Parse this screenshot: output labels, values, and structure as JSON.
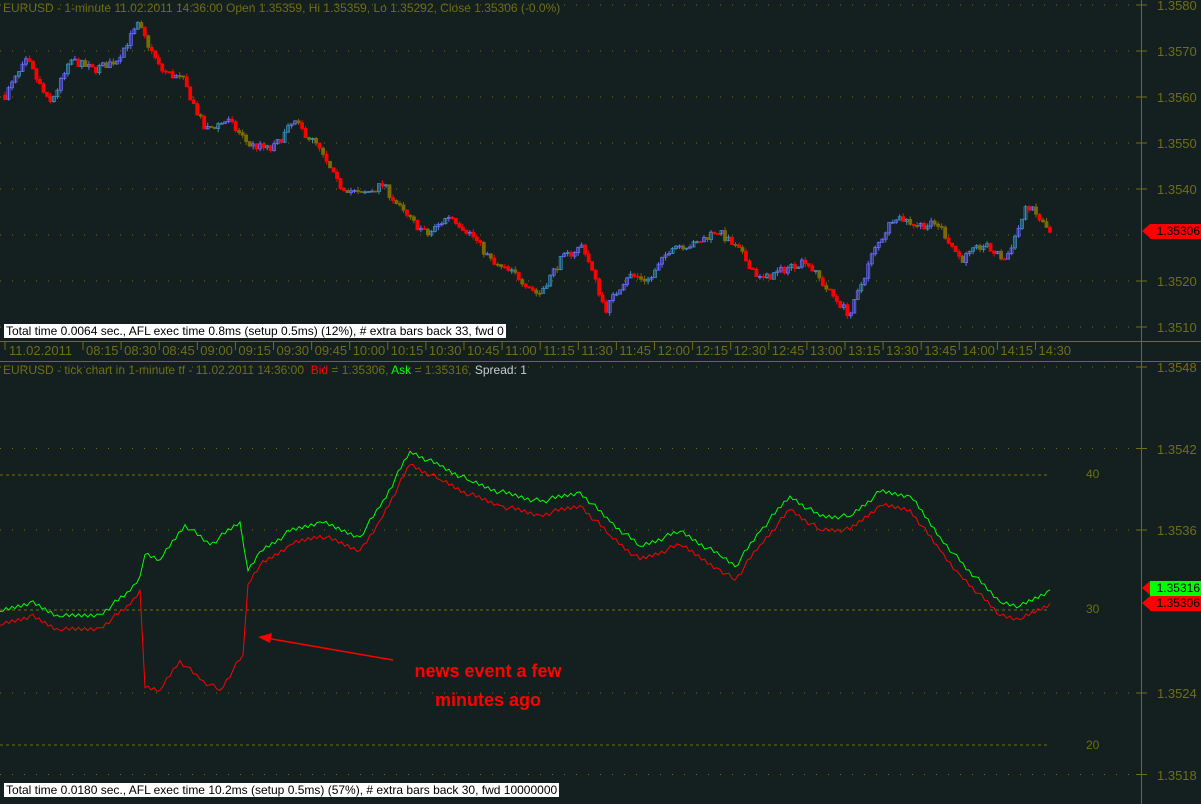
{
  "top_pane": {
    "title": "EURUSD - 1-minute 11.02.2011 14:36:00 Open 1.35359, Hi 1.35359, Lo 1.35292, Close 1.35306 (-0.0%)",
    "status": "Total time 0.0064 sec., AFL exec time 0.8ms (setup 0.5ms) (12%), # extra bars back 33, fwd 0",
    "price_labels": [
      "1.3580",
      "1.3570",
      "1.3560",
      "1.3550",
      "1.3540",
      "1.3520",
      "1.3510"
    ],
    "last_price": "1.35306"
  },
  "time_axis": {
    "date": "11.02.2011",
    "labels": [
      "08:15",
      "08:30",
      "08:45",
      "09:00",
      "09:15",
      "09:30",
      "09:45",
      "10:00",
      "10:15",
      "10:30",
      "10:45",
      "11:00",
      "11:15",
      "11:30",
      "11:45",
      "12:00",
      "12:15",
      "12:30",
      "12:45",
      "13:00",
      "13:15",
      "13:30",
      "13:45",
      "14:00",
      "14:15",
      "14:30"
    ]
  },
  "bottom_pane": {
    "title": "EURUSD - tick chart in 1-minute tf - 11.02.2011 14:36:00",
    "bid_label": "Bid",
    "bid_value": " = 1.35306, ",
    "ask_label": "Ask",
    "ask_value": " = 1.35316, ",
    "spread": "Spread: 1",
    "status": "Total time 0.0180 sec., AFL exec time 10.2ms (setup 0.5ms) (57%), # extra bars back 30, fwd 10000000",
    "price_labels": [
      "1.3548",
      "1.3542",
      "1.3536",
      "1.3524",
      "1.3518"
    ],
    "spread_scale": [
      "40",
      "30",
      "20"
    ],
    "ask_tag": "1.35316",
    "bid_tag": "1.35306",
    "annotation": [
      "news event a few",
      "minutes ago"
    ]
  },
  "colors": {
    "bg": "#142020",
    "axis": "#6e6e14",
    "bid": "#ff0000",
    "ask": "#00ff00",
    "up": "#3a90c0",
    "down": "#ff0000"
  },
  "chart_data": [
    {
      "type": "candlestick",
      "title": "EURUSD 1-minute",
      "ylim": [
        1.3507,
        1.3581
      ],
      "closes": [
        1.35604,
        1.3568,
        1.35583,
        1.3568,
        1.35659,
        1.3568,
        1.35757,
        1.35659,
        1.35637,
        1.35528,
        1.3555,
        1.35496,
        1.35485,
        1.35546,
        1.35496,
        1.35409,
        1.35387,
        1.35409,
        1.35343,
        1.353,
        1.35343,
        1.353,
        1.35235,
        1.35213,
        1.3517,
        1.35246,
        1.35278,
        1.35137,
        1.35213,
        1.35202,
        1.35278,
        1.35278,
        1.35311,
        1.35267,
        1.35202,
        1.35224,
        1.35246,
        1.3518,
        1.35126,
        1.35257,
        1.35343,
        1.35322,
        1.35322,
        1.35246,
        1.35278,
        1.35246,
        1.35365,
        1.35306
      ]
    },
    {
      "type": "line",
      "title": "EURUSD tick chart",
      "ylim": [
        1.3517,
        1.3549
      ],
      "series": [
        {
          "name": "Bid",
          "x": [
            0,
            6,
            12,
            20,
            26,
            28,
            29,
            32,
            36,
            40,
            44,
            48.6,
            49.6,
            52,
            58,
            64,
            72,
            76,
            82,
            88,
            94,
            100,
            108,
            116,
            122,
            128,
            136,
            144,
            147,
            152,
            158,
            164,
            170,
            176,
            182,
            188,
            192,
            200,
            204,
            210
          ],
          "values": [
            1.3529,
            1.35297,
            1.35286,
            1.35288,
            1.35305,
            1.35316,
            1.35244,
            1.35242,
            1.35264,
            1.3525,
            1.35242,
            1.35268,
            1.3532,
            1.35334,
            1.35349,
            1.35356,
            1.35345,
            1.35367,
            1.35408,
            1.35397,
            1.35386,
            1.35378,
            1.35371,
            1.35378,
            1.35356,
            1.35338,
            1.35349,
            1.35331,
            1.35323,
            1.35349,
            1.35375,
            1.3536,
            1.3536,
            1.35378,
            1.35375,
            1.35345,
            1.35327,
            1.35297,
            1.35294,
            1.35306
          ]
        },
        {
          "name": "Ask",
          "x": [
            0,
            6,
            12,
            20,
            26,
            28,
            29,
            32,
            37,
            42,
            48,
            49.6,
            52,
            58,
            64,
            72,
            76,
            82,
            88,
            94,
            100,
            108,
            116,
            122,
            128,
            136,
            144,
            147,
            152,
            158,
            164,
            170,
            176,
            182,
            188,
            192,
            200,
            204,
            210
          ],
          "values": [
            1.353,
            1.35307,
            1.35296,
            1.35298,
            1.35315,
            1.35326,
            1.35342,
            1.35338,
            1.35364,
            1.35349,
            1.35366,
            1.3533,
            1.35344,
            1.35359,
            1.35366,
            1.35355,
            1.35377,
            1.35418,
            1.35407,
            1.35396,
            1.35388,
            1.35381,
            1.35388,
            1.35366,
            1.35348,
            1.35359,
            1.35341,
            1.35333,
            1.35359,
            1.35385,
            1.3537,
            1.3537,
            1.35388,
            1.35385,
            1.35355,
            1.35337,
            1.35307,
            1.35304,
            1.35316
          ]
        }
      ]
    }
  ]
}
